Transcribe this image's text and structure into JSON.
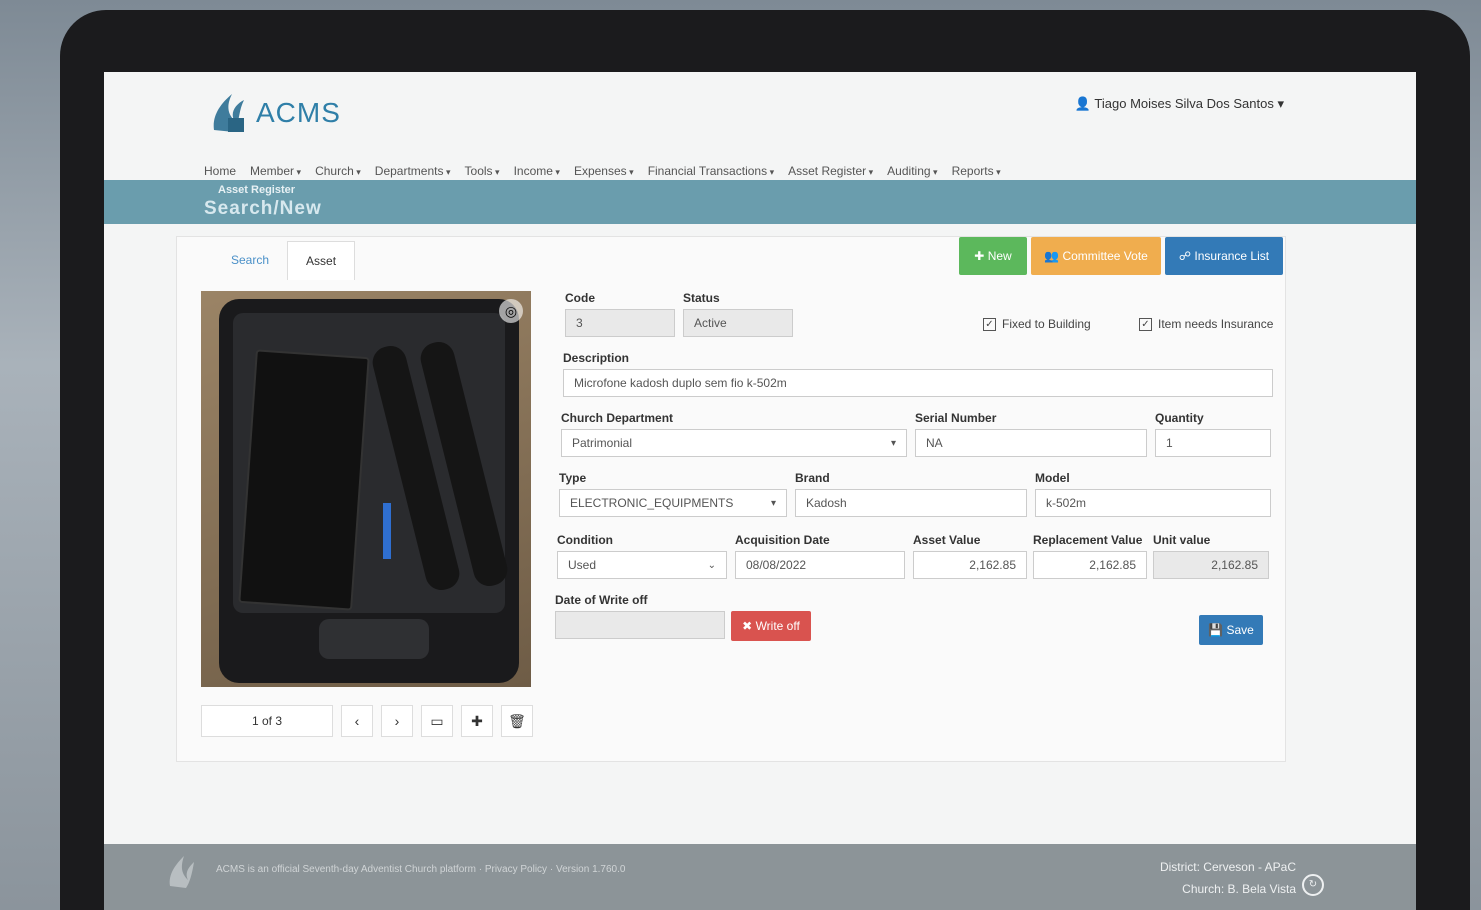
{
  "app": {
    "logo_text": "ACMS",
    "user": "Tiago Moises Silva Dos Santos"
  },
  "nav": [
    "Home",
    "Member",
    "Church",
    "Departments",
    "Tools",
    "Income",
    "Expenses",
    "Financial Transactions",
    "Asset Register",
    "Auditing",
    "Reports"
  ],
  "band": {
    "subtitle": "Asset Register",
    "title": "Search/New"
  },
  "tabs": {
    "search": "Search",
    "asset": "Asset"
  },
  "buttons": {
    "new": "New",
    "committee": "Committee Vote",
    "insurance": "Insurance List",
    "write_off": "Write off",
    "save": "Save"
  },
  "form": {
    "code_label": "Code",
    "code_value": "3",
    "status_label": "Status",
    "status_value": "Active",
    "fixed_label": "Fixed to Building",
    "insurance_label": "Item needs Insurance",
    "description_label": "Description",
    "description_value": "Microfone kadosh duplo sem fio k-502m",
    "dept_label": "Church Department",
    "dept_value": "Patrimonial",
    "serial_label": "Serial Number",
    "serial_value": "NA",
    "qty_label": "Quantity",
    "qty_value": "1",
    "type_label": "Type",
    "type_value": "ELECTRONIC_EQUIPMENTS",
    "brand_label": "Brand",
    "brand_value": "Kadosh",
    "model_label": "Model",
    "model_value": "k-502m",
    "condition_label": "Condition",
    "condition_value": "Used",
    "acq_label": "Acquisition Date",
    "acq_value": "08/08/2022",
    "asset_value_label": "Asset Value",
    "asset_value": "2,162.85",
    "replacement_label": "Replacement Value",
    "replacement_value": "2,162.85",
    "unit_label": "Unit value",
    "unit_value": "2,162.85",
    "writeoff_label": "Date of Write off"
  },
  "pager": {
    "count": "1 of 3"
  },
  "footer": {
    "text": "ACMS is an official Seventh-day Adventist Church platform · Privacy Policy · Version 1.760.0",
    "district": "District: Cerveson - APaC",
    "church": "Church: B. Bela Vista"
  },
  "colors": {
    "band": "#6a9dad",
    "new": "#5cb85c",
    "committee": "#f0ad4e",
    "insurance": "#337ab7",
    "write_off": "#d9534f",
    "save": "#337ab7"
  }
}
